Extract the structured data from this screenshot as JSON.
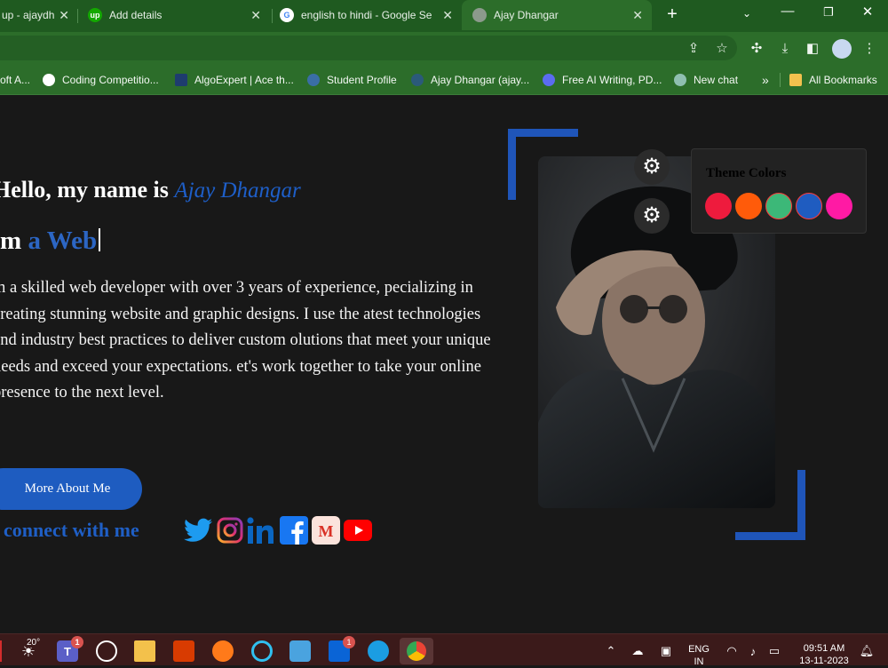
{
  "browser": {
    "tabs": [
      {
        "title": "up - ajaydh",
        "favicon": "upwork-icon"
      },
      {
        "title": "Add details",
        "favicon": "upwork-icon"
      },
      {
        "title": "english to hindi - Google Se",
        "favicon": "google-icon"
      },
      {
        "title": "Ajay Dhangar",
        "favicon": "globe-icon",
        "active": true
      }
    ],
    "new_tab": "+",
    "bookmarks": [
      {
        "label": "oft A..."
      },
      {
        "label": "Coding Competitio..."
      },
      {
        "label": "AlgoExpert | Ace th..."
      },
      {
        "label": "Student Profile"
      },
      {
        "label": "Ajay Dhangar (ajay..."
      },
      {
        "label": "Free AI Writing, PD..."
      },
      {
        "label": "New chat"
      },
      {
        "label": "All Bookmarks"
      }
    ],
    "more_bookmarks": "»"
  },
  "hero": {
    "greeting": "Hello, my name is ",
    "name": "Ajay Dhangar",
    "role_prefix": "'m ",
    "role_typed": "a Web",
    "description": "m a skilled web developer with over 3 years of experience, pecializing in creating stunning website and graphic designs. I use the atest technologies and industry best practices to deliver custom olutions that meet your unique needs and exceed your expectations. et's work together to take your online presence to the next level.",
    "button": "More About Me",
    "connect": "connect with me"
  },
  "socials": [
    "twitter-icon",
    "instagram-icon",
    "linkedin-icon",
    "facebook-icon",
    "gmail-icon",
    "youtube-icon"
  ],
  "theme_panel": {
    "title": "Theme Colors",
    "colors": [
      "#ee1b3d",
      "#ff5b0a",
      "#3cb878",
      "#1f5cc0",
      "#ff1aa4"
    ]
  },
  "taskbar": {
    "weather": "20°",
    "teams_badge": "1",
    "mail_badge": "1",
    "lang_top": "ENG",
    "lang_bottom": "IN",
    "time": "09:51 AM",
    "date": "13-11-2023"
  },
  "colors": {
    "accent": "#1f5cc0",
    "chrome": "#2c6d2a"
  }
}
